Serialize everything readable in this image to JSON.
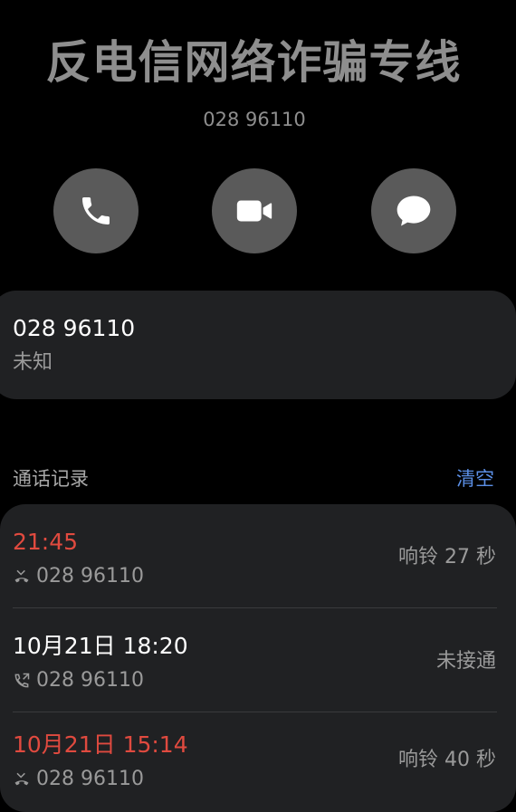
{
  "contact": {
    "name": "反电信网络诈骗专线",
    "number": "028 96110"
  },
  "actions": {
    "call_icon": "phone-icon",
    "video_icon": "video-camera-icon",
    "message_icon": "message-bubble-icon"
  },
  "info": {
    "number": "028 96110",
    "location": "未知"
  },
  "call_log": {
    "header": "通话记录",
    "clear_label": "清空",
    "entries": [
      {
        "time": "21:45",
        "number": "028 96110",
        "status": "响铃 27 秒",
        "type": "missed",
        "time_color": "#e04a3f"
      },
      {
        "time": "10月21日 18:20",
        "number": "028 96110",
        "status": "未接通",
        "type": "outgoing",
        "time_color": "#ffffff"
      },
      {
        "time": "10月21日 15:14",
        "number": "028 96110",
        "status": "响铃 40 秒",
        "type": "missed",
        "time_color": "#e04a3f"
      }
    ]
  },
  "colors": {
    "background": "#000000",
    "card": "#202123",
    "button": "#5a5a5a",
    "accent": "#5b8fe6",
    "missed": "#e04a3f",
    "secondary_text": "#9a9a9a"
  }
}
